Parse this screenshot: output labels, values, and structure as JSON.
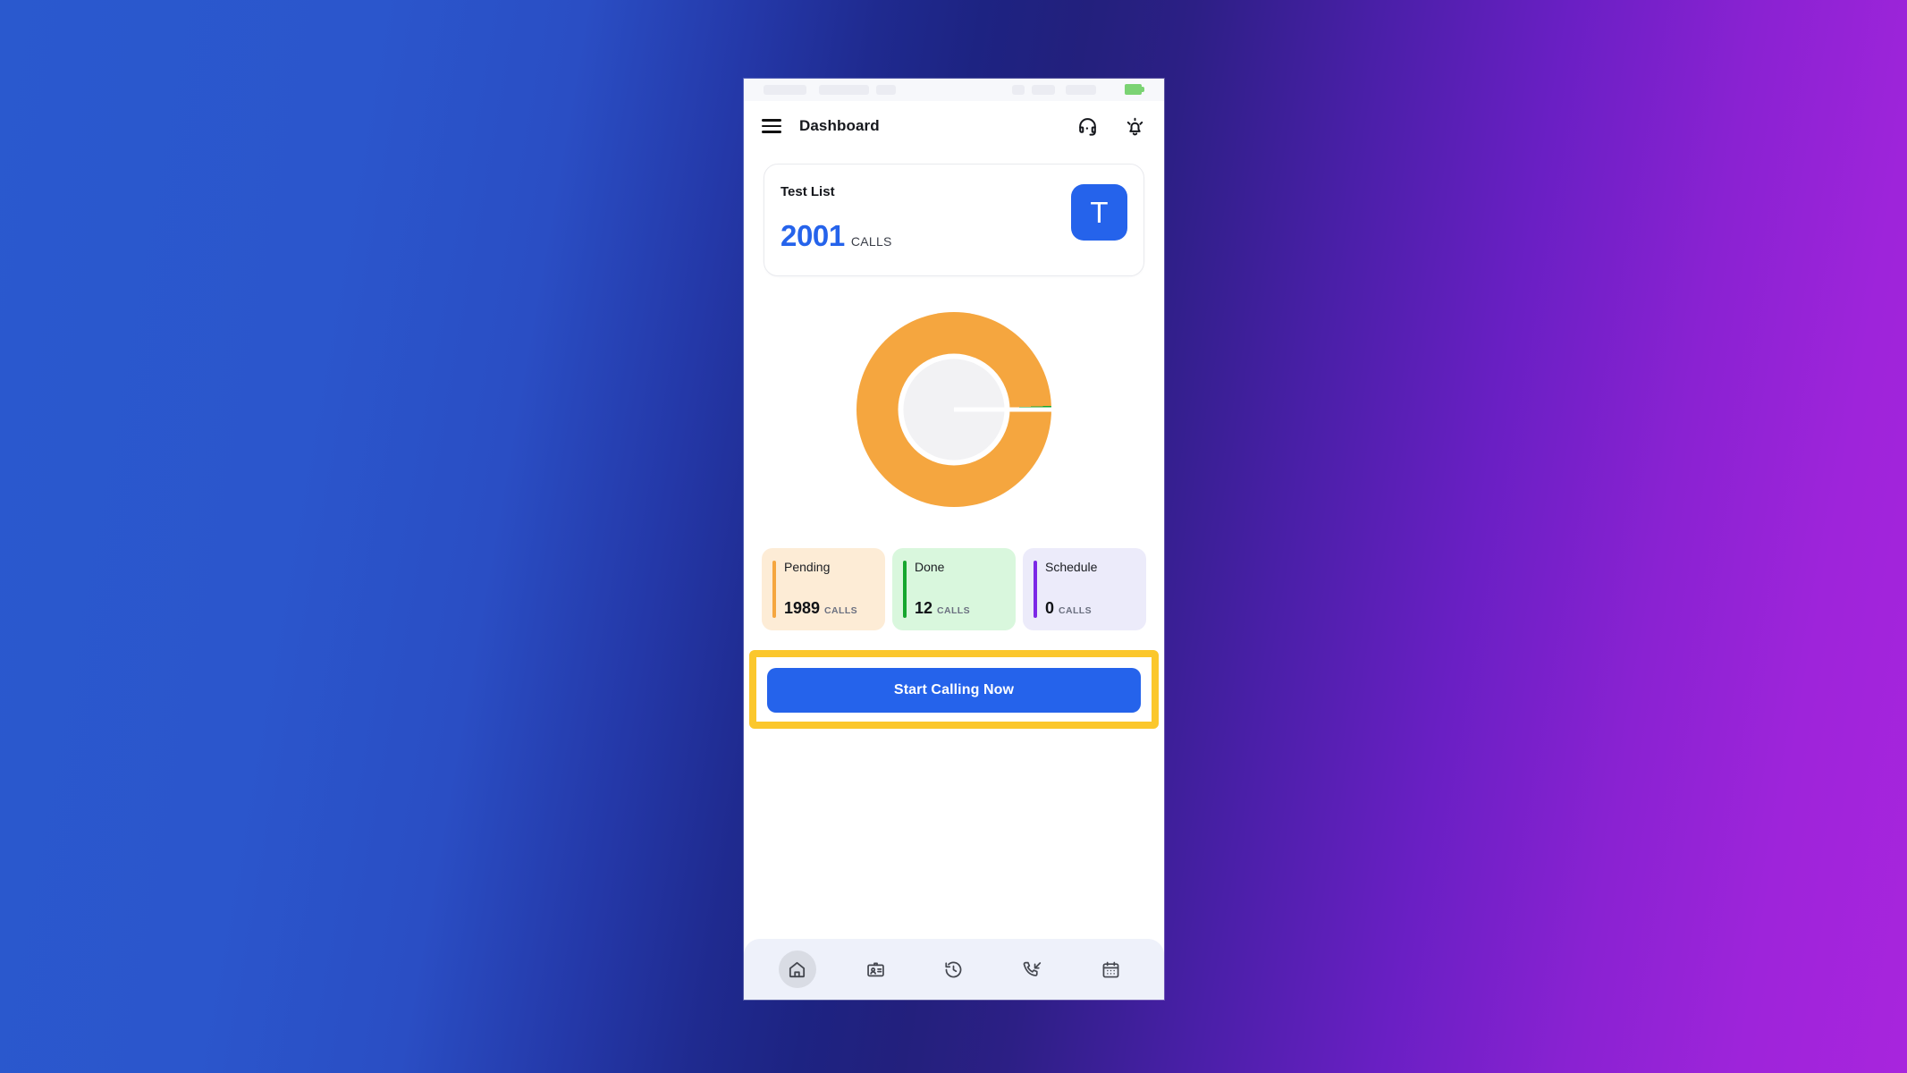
{
  "background": {
    "gradient_from": "#2a59ce",
    "gradient_mid": "#1d2382",
    "gradient_to": "#a825dd"
  },
  "statusbar": {
    "battery_icon": "battery-icon",
    "battery_color": "#56c94a"
  },
  "appbar": {
    "menu_icon": "hamburger-menu-icon",
    "title": "Dashboard",
    "support_icon": "headset-support-icon",
    "notification_icon": "notification-bell-icon"
  },
  "list_card": {
    "title": "Test List",
    "count": "2001",
    "count_unit": "CALLS",
    "avatar_letter": "T",
    "avatar_color": "#2563eb",
    "count_color": "#2563eb"
  },
  "donut": {
    "label": "call-status-donut-chart",
    "track_color": "#f5a63f",
    "hole_color": "#f2f2f4"
  },
  "chart_data": {
    "type": "pie",
    "title": "",
    "categories": [
      "Pending",
      "Done",
      "Schedule"
    ],
    "values": [
      1989,
      12,
      0
    ],
    "colors": [
      "#f5a63f",
      "#16a62e",
      "#7c28e6"
    ],
    "total": 2001,
    "unit": "CALLS",
    "legend": "below",
    "grid": false
  },
  "stats": [
    {
      "label": "Pending",
      "value": "1989",
      "unit": "CALLS",
      "bar_color": "#f5a63f",
      "bg_color": "#fdecd6",
      "name": "pending"
    },
    {
      "label": "Done",
      "value": "12",
      "unit": "CALLS",
      "bar_color": "#16a62e",
      "bg_color": "#d9f7dd",
      "name": "done"
    },
    {
      "label": "Schedule",
      "value": "0",
      "unit": "CALLS",
      "bar_color": "#7c28e6",
      "bg_color": "#ecebfa",
      "name": "schedule"
    }
  ],
  "cta": {
    "label": "Start Calling Now",
    "button_color": "#2563eb",
    "highlight_color": "#fbc72c"
  },
  "bottomnav": {
    "items": [
      {
        "icon": "home-icon",
        "active": true
      },
      {
        "icon": "contact-card-icon",
        "active": false
      },
      {
        "icon": "history-clock-icon",
        "active": false
      },
      {
        "icon": "incoming-call-icon",
        "active": false
      },
      {
        "icon": "calendar-icon",
        "active": false
      }
    ]
  }
}
